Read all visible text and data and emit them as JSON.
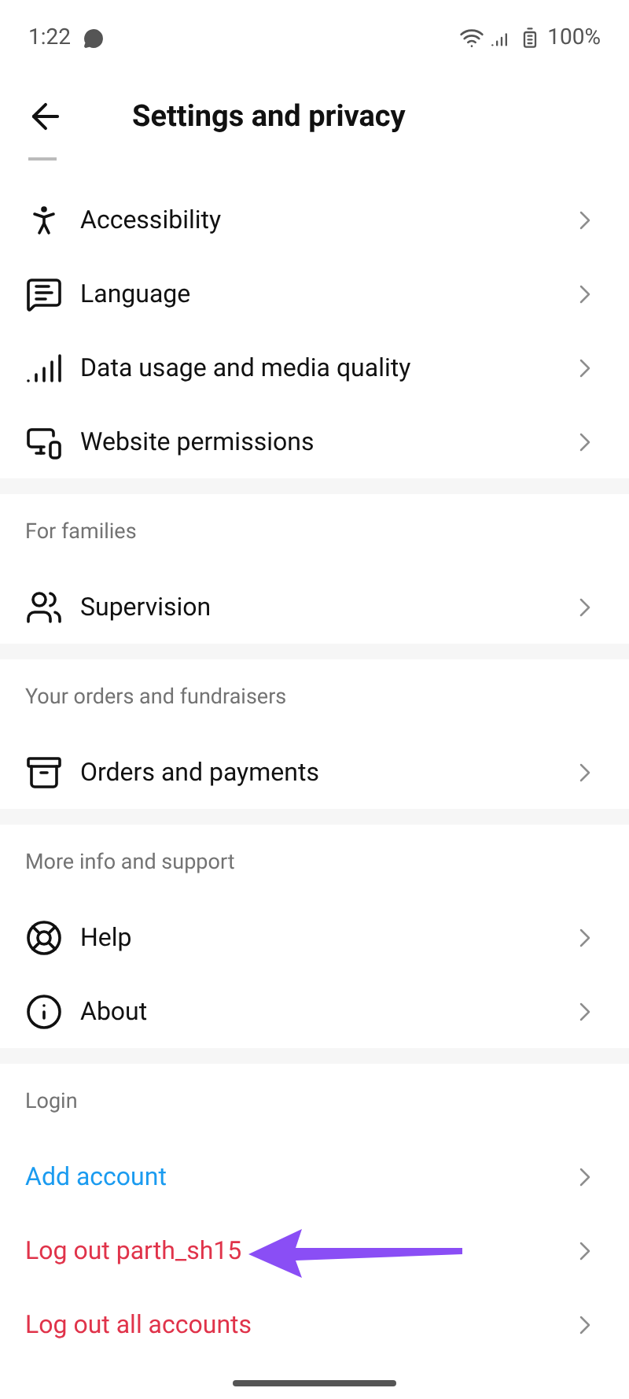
{
  "status_bar": {
    "time": "1:22",
    "battery": "100%"
  },
  "header": {
    "title": "Settings and privacy"
  },
  "sections": [
    {
      "items": [
        {
          "label": "Accessibility",
          "kind": "plain"
        },
        {
          "label": "Language",
          "kind": "plain"
        },
        {
          "label": "Data usage and media quality",
          "kind": "plain"
        },
        {
          "label": "Website permissions",
          "kind": "plain"
        }
      ]
    },
    {
      "title": "For families",
      "items": [
        {
          "label": "Supervision",
          "kind": "plain"
        }
      ]
    },
    {
      "title": "Your orders and fundraisers",
      "items": [
        {
          "label": "Orders and payments",
          "kind": "plain"
        }
      ]
    },
    {
      "title": "More info and support",
      "items": [
        {
          "label": "Help",
          "kind": "plain"
        },
        {
          "label": "About",
          "kind": "plain"
        }
      ]
    },
    {
      "title": "Login",
      "items": [
        {
          "label": "Add account",
          "kind": "link"
        },
        {
          "label": "Log out parth_sh15",
          "kind": "danger"
        },
        {
          "label": "Log out all accounts",
          "kind": "danger"
        }
      ]
    }
  ]
}
